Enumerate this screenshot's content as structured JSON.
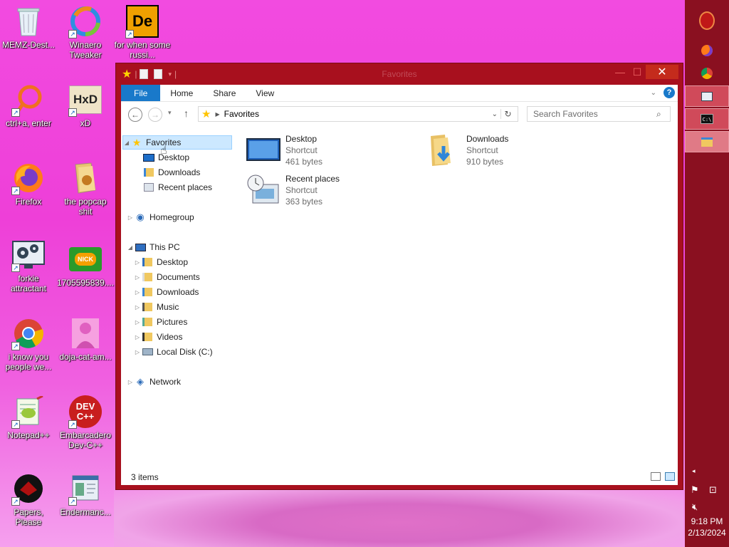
{
  "desktop": {
    "icons": [
      {
        "label": "MEMZ-Dest...",
        "icon": "recycle-bin-icon"
      },
      {
        "label": "Winaero Tweaker",
        "icon": "winaero-icon"
      },
      {
        "label": "for when some russi...",
        "icon": "de-app-icon",
        "glyph": "De"
      },
      {
        "label": "ctrl+a, enter",
        "icon": "orange-ring-icon"
      },
      {
        "label": "xD",
        "icon": "hxd-icon",
        "glyph": "HxD"
      },
      {
        "label": "Firefox",
        "icon": "firefox-icon"
      },
      {
        "label": "the popcap shit",
        "icon": "folder-icon"
      },
      {
        "label": "forkie attractant",
        "icon": "settings-monitor-icon"
      },
      {
        "label": "1705595839....",
        "icon": "nick-image-icon",
        "glyph": "NICK"
      },
      {
        "label": "i know you people we...",
        "icon": "chrome-icon"
      },
      {
        "label": "doja-cat-am...",
        "icon": "photo-icon"
      },
      {
        "label": "Notepad++",
        "icon": "notepadpp-icon"
      },
      {
        "label": "Embarcadero Dev-C++",
        "icon": "devcpp-icon",
        "glyph": "DEV C++"
      },
      {
        "label": "Papers, Please",
        "icon": "papers-please-icon"
      },
      {
        "label": "Endermanc...",
        "icon": "endermanch-icon"
      }
    ]
  },
  "taskbar": {
    "items": [
      {
        "name": "ornament-icon"
      },
      {
        "name": "firefox-icon"
      },
      {
        "name": "chrome-icon"
      },
      {
        "name": "image-viewer-icon"
      },
      {
        "name": "cmd-icon",
        "glyph": "C:\\"
      },
      {
        "name": "file-explorer-icon"
      }
    ],
    "tray": {
      "time": "9:18 PM",
      "date": "2/13/2024"
    }
  },
  "window": {
    "title": "Favorites",
    "close_glyph": "✕",
    "ribbon": {
      "tabs": [
        "File",
        "Home",
        "Share",
        "View"
      ],
      "help": "?"
    },
    "address": {
      "location": "Favorites"
    },
    "search": {
      "placeholder": "Search Favorites"
    },
    "nav_tree": {
      "favorites": {
        "label": "Favorites",
        "children": [
          "Desktop",
          "Downloads",
          "Recent places"
        ]
      },
      "homegroup": "Homegroup",
      "this_pc": {
        "label": "This PC",
        "children": [
          "Desktop",
          "Documents",
          "Downloads",
          "Music",
          "Pictures",
          "Videos",
          "Local Disk (C:)"
        ]
      },
      "network": "Network"
    },
    "files": [
      {
        "name": "Desktop",
        "type": "Shortcut",
        "size": "461 bytes"
      },
      {
        "name": "Downloads",
        "type": "Shortcut",
        "size": "910 bytes"
      },
      {
        "name": "Recent places",
        "type": "Shortcut",
        "size": "363 bytes"
      }
    ],
    "status": {
      "count": "3 items"
    }
  },
  "colors": {
    "window_frame": "#a8101e",
    "accent": "#1979ca",
    "taskbar": "#8a1020",
    "wallpaper": "#f24be0"
  }
}
